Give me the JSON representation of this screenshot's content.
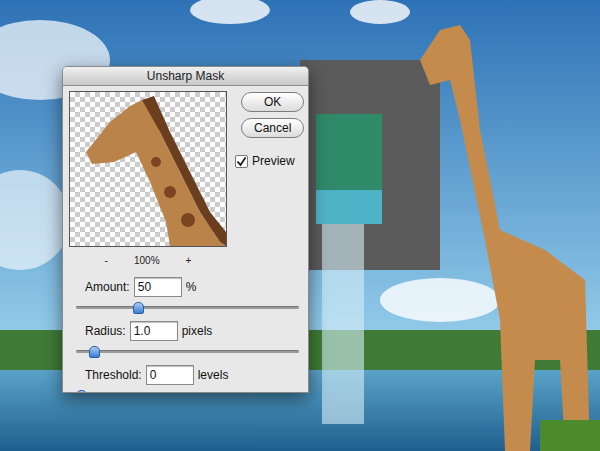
{
  "window": {
    "title": "Unsharp Mask"
  },
  "buttons": [
    "OK",
    "Cancel"
  ],
  "preview": {
    "label": "Preview",
    "checked": true
  },
  "zoom": {
    "out": "-",
    "value": "100%",
    "in": "+"
  },
  "controls": [
    {
      "label": "Amount:",
      "value": "50",
      "unit": "%",
      "level": 0.27
    },
    {
      "label": "Radius:",
      "value": "1.0",
      "unit": "pixels",
      "level": 0.06
    },
    {
      "label": "Threshold:",
      "value": "0",
      "unit": "levels",
      "level": 0
    }
  ]
}
